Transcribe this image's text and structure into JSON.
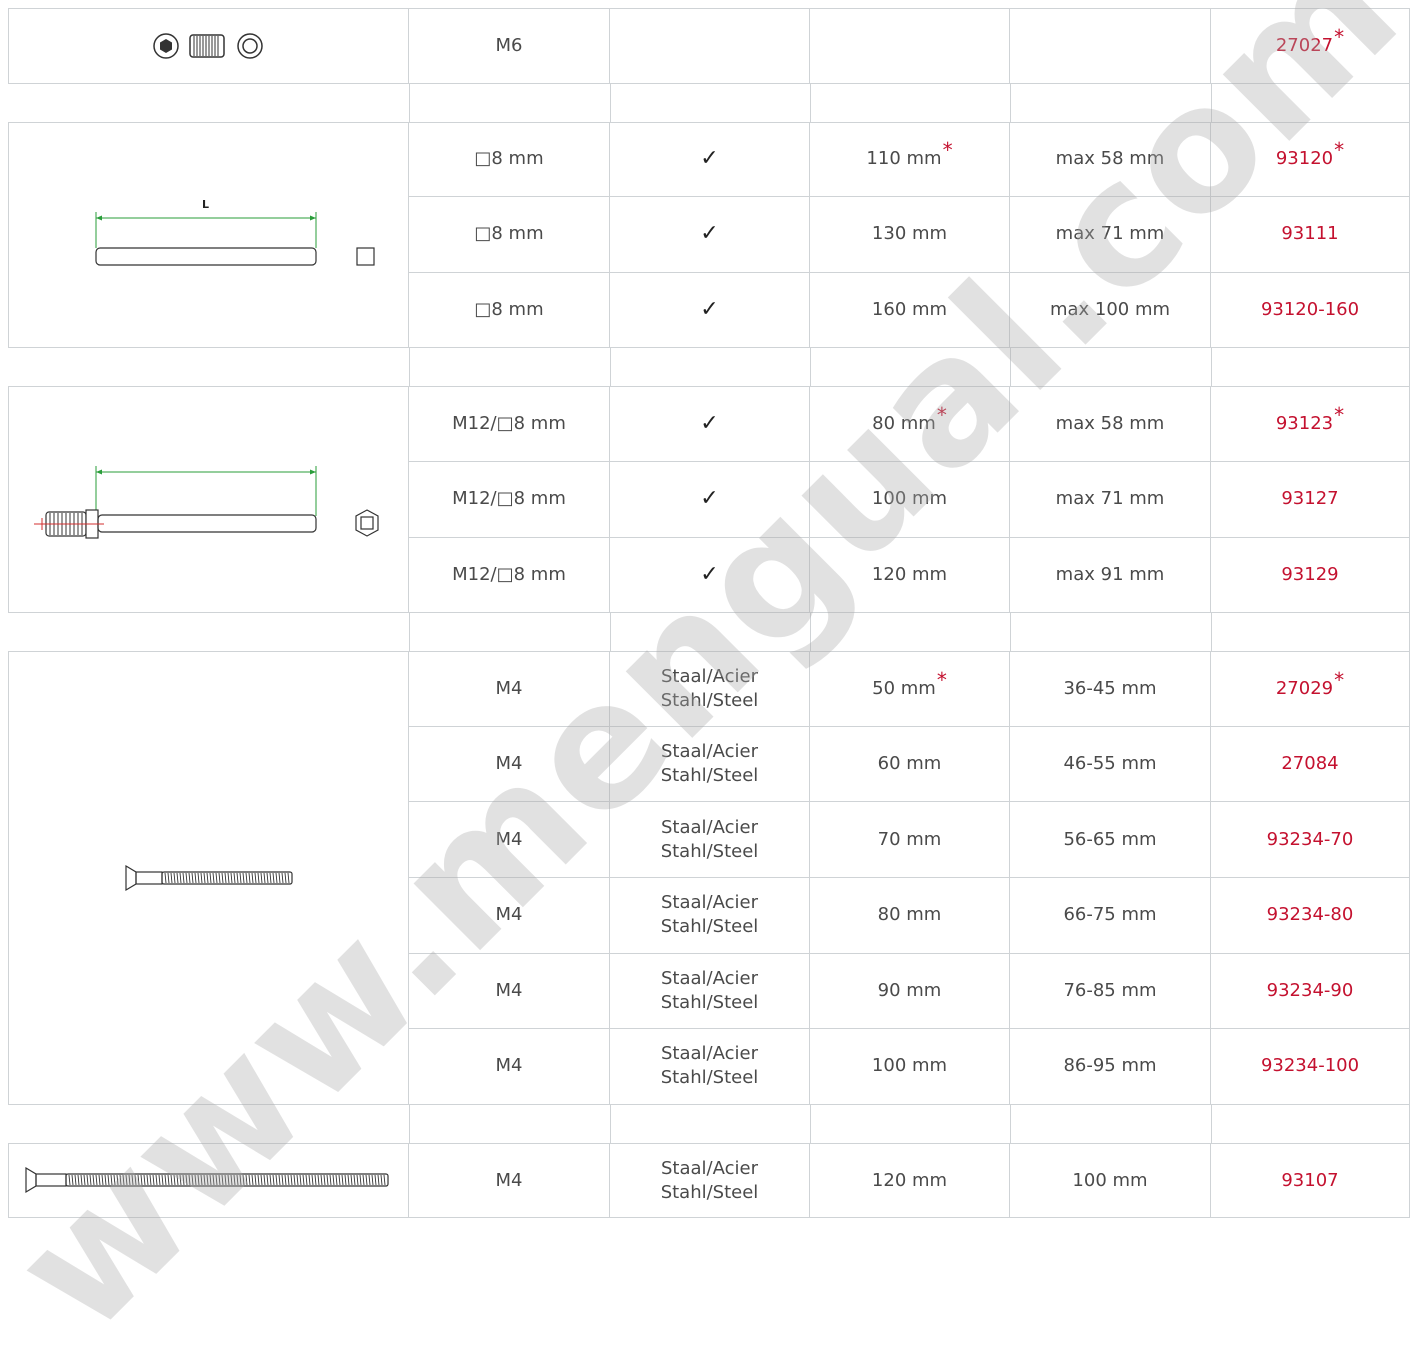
{
  "groups": [
    {
      "illustration": "insert-nut-icons",
      "rows": [
        {
          "thread": "M6",
          "material": "",
          "check": "",
          "length": "",
          "thickness": "",
          "code": "27027",
          "star_code": true,
          "star_length": false
        }
      ]
    },
    {
      "illustration": "square-rod",
      "dimension_label": "L",
      "rows": [
        {
          "thread": "□8 mm",
          "material": "",
          "check": "✓",
          "length": "110 mm",
          "thickness": "max 58 mm",
          "code": "93120",
          "star_code": true,
          "star_length": true
        },
        {
          "thread": "□8 mm",
          "material": "",
          "check": "✓",
          "length": "130 mm",
          "thickness": "max 71 mm",
          "code": "93111",
          "star_code": false,
          "star_length": false
        },
        {
          "thread": "□8 mm",
          "material": "",
          "check": "✓",
          "length": "160 mm",
          "thickness": "max 100 mm",
          "code": "93120-160",
          "star_code": false,
          "star_length": false
        }
      ]
    },
    {
      "illustration": "threaded-square-rod",
      "dimension_label": "L",
      "rows": [
        {
          "thread": "M12/□8 mm",
          "material": "",
          "check": "✓",
          "length": "80 mm",
          "thickness": "max 58 mm",
          "code": "93123",
          "star_code": true,
          "star_length": true
        },
        {
          "thread": "M12/□8 mm",
          "material": "",
          "check": "✓",
          "length": "100 mm",
          "thickness": "max 71 mm",
          "code": "93127",
          "star_code": false,
          "star_length": false
        },
        {
          "thread": "M12/□8 mm",
          "material": "",
          "check": "✓",
          "length": "120 mm",
          "thickness": "max 91 mm",
          "code": "93129",
          "star_code": false,
          "star_length": false
        }
      ]
    },
    {
      "illustration": "countersunk-screw",
      "rows": [
        {
          "thread": "M4",
          "material": [
            "Staal/Acier",
            "Stahl/Steel"
          ],
          "check": "",
          "length": "50 mm",
          "thickness": "36-45 mm",
          "code": "27029",
          "star_code": true,
          "star_length": true
        },
        {
          "thread": "M4",
          "material": [
            "Staal/Acier",
            "Stahl/Steel"
          ],
          "check": "",
          "length": "60 mm",
          "thickness": "46-55 mm",
          "code": "27084",
          "star_code": false,
          "star_length": false
        },
        {
          "thread": "M4",
          "material": [
            "Staal/Acier",
            "Stahl/Steel"
          ],
          "check": "",
          "length": "70 mm",
          "thickness": "56-65 mm",
          "code": "93234-70",
          "star_code": false,
          "star_length": false
        },
        {
          "thread": "M4",
          "material": [
            "Staal/Acier",
            "Stahl/Steel"
          ],
          "check": "",
          "length": "80 mm",
          "thickness": "66-75 mm",
          "code": "93234-80",
          "star_code": false,
          "star_length": false
        },
        {
          "thread": "M4",
          "material": [
            "Staal/Acier",
            "Stahl/Steel"
          ],
          "check": "",
          "length": "90 mm",
          "thickness": "76-85 mm",
          "code": "93234-90",
          "star_code": false,
          "star_length": false
        },
        {
          "thread": "M4",
          "material": [
            "Staal/Acier",
            "Stahl/Steel"
          ],
          "check": "",
          "length": "100 mm",
          "thickness": "86-95 mm",
          "code": "93234-100",
          "star_code": false,
          "star_length": false
        }
      ]
    },
    {
      "illustration": "long-breakable-screw",
      "rows": [
        {
          "thread": "M4",
          "material": [
            "Staal/Acier",
            "Stahl/Steel"
          ],
          "check": "",
          "length": "120 mm",
          "thickness": "100 mm",
          "code": "93107",
          "star_code": false,
          "star_length": false
        }
      ]
    }
  ],
  "star_symbol": "*",
  "watermark": "www.mengual.com",
  "colors": {
    "code": "#c4112f",
    "grid": "#cfd3d6",
    "text": "#4a4a4a"
  }
}
